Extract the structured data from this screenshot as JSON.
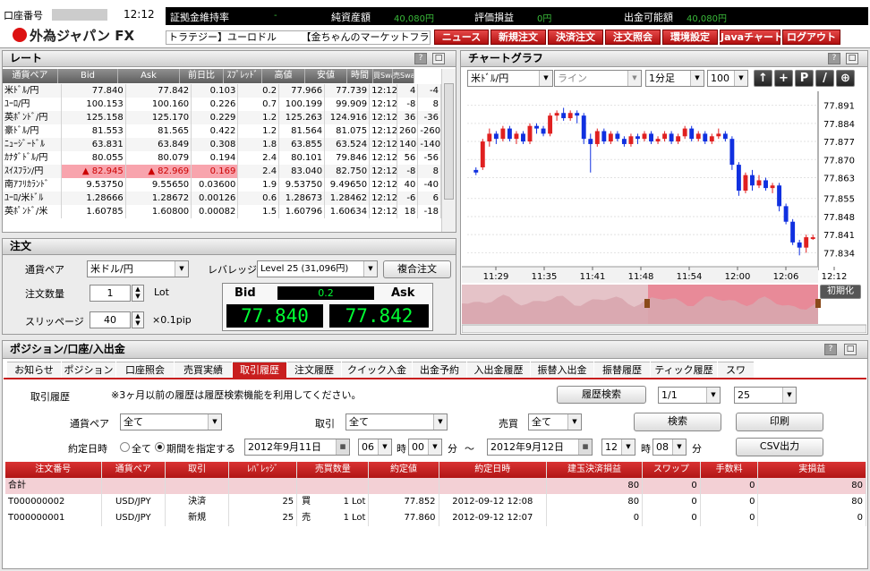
{
  "colors": {
    "accent": "#c81e1e",
    "up": "#e02020",
    "down": "#1030e0",
    "bid_green": "#00ff33"
  },
  "header": {
    "account_label": "口座番号",
    "time": "12:12",
    "logo": "外為ジャパン FX",
    "stats": [
      {
        "label": "証拠金維持率",
        "value": "-"
      },
      {
        "label": "純資産額",
        "value": "40,080円"
      },
      {
        "label": "評価損益",
        "value": "0円"
      },
      {
        "label": "出金可能額",
        "value": "40,080円"
      }
    ],
    "ticker": "トラテジー】ユーロドル　　　【金ちゃんのマーケットフラッ",
    "buttons": [
      "ニュース",
      "新規注文",
      "決済注文",
      "注文照会",
      "環境設定",
      "Javaチャート",
      "ログアウト"
    ]
  },
  "rate": {
    "title": "レート",
    "columns": [
      "通貨ペア",
      "Bid",
      "Ask",
      "前日比",
      "ｽﾌﾟﾚｯﾄﾞ",
      "高値",
      "安値",
      "時間",
      "買Swap",
      "売Swap"
    ],
    "rows": [
      [
        "米ﾄﾞﾙ/円",
        "77.840",
        "77.842",
        "0.103",
        "0.2",
        "77.966",
        "77.739",
        "12:12",
        "4",
        "-4"
      ],
      [
        "ﾕｰﾛ/円",
        "100.153",
        "100.160",
        "0.226",
        "0.7",
        "100.199",
        "99.909",
        "12:12",
        "-8",
        "8"
      ],
      [
        "英ﾎﾟﾝﾄﾞ/円",
        "125.158",
        "125.170",
        "0.229",
        "1.2",
        "125.263",
        "124.916",
        "12:12",
        "36",
        "-36"
      ],
      [
        "豪ﾄﾞﾙ/円",
        "81.553",
        "81.565",
        "0.422",
        "1.2",
        "81.564",
        "81.075",
        "12:12",
        "260",
        "-260"
      ],
      [
        "ﾆｭｰｼﾞｰﾄﾞﾙ",
        "63.831",
        "63.849",
        "0.308",
        "1.8",
        "63.855",
        "63.524",
        "12:12",
        "140",
        "-140"
      ],
      [
        "ｶﾅﾀﾞﾄﾞﾙ/円",
        "80.055",
        "80.079",
        "0.194",
        "2.4",
        "80.101",
        "79.846",
        "12:12",
        "56",
        "-56"
      ],
      [
        "ｽｲｽﾌﾗﾝ/円",
        "82.945",
        "82.969",
        "0.169",
        "2.4",
        "83.040",
        "82.750",
        "12:12",
        "-8",
        "8"
      ],
      [
        "南ｱﾌﾘｶﾗﾝﾄﾞ",
        "9.53750",
        "9.55650",
        "0.03600",
        "1.9",
        "9.53750",
        "9.49650",
        "12:12",
        "40",
        "-40"
      ],
      [
        "ﾕｰﾛ/米ﾄﾞﾙ",
        "1.28666",
        "1.28672",
        "0.00126",
        "0.6",
        "1.28673",
        "1.28462",
        "12:12",
        "-6",
        "6"
      ],
      [
        "英ﾎﾟﾝﾄﾞ/米",
        "1.60785",
        "1.60800",
        "0.00082",
        "1.5",
        "1.60796",
        "1.60634",
        "12:12",
        "18",
        "-18"
      ]
    ]
  },
  "order": {
    "title": "注文",
    "pair_label": "通貨ペア",
    "pair_value": "米ドル/円",
    "leverage_label": "レバレッジ",
    "leverage_value": "Level 25 (31,096円)",
    "combo_button": "複合注文",
    "qty_label": "注文数量",
    "qty_value": "1",
    "qty_unit": "Lot",
    "slip_label": "スリッページ",
    "slip_value": "40",
    "slip_unit": "×0.1pip",
    "bid_label": "Bid",
    "ask_label": "Ask",
    "spread": "0.2",
    "bid": "77.840",
    "ask": "77.842"
  },
  "chart": {
    "title": "チャートグラフ",
    "pair": "米ﾄﾞﾙ/円",
    "style": "ライン",
    "period": "1分足",
    "count": "100",
    "tools": [
      "↑",
      "+",
      "P",
      "/",
      "⊕"
    ],
    "reset_button": "初期化",
    "chart_data": {
      "type": "candlestick",
      "ylim": [
        77.83,
        77.895
      ],
      "yticks": [
        "77.891",
        "77.884",
        "77.877",
        "77.870",
        "77.863",
        "77.855",
        "77.848",
        "77.841",
        "77.834"
      ],
      "xticks": [
        "11:29",
        "11:35",
        "11:41",
        "11:48",
        "11:54",
        "12:00",
        "12:06",
        "12:12"
      ],
      "candles": [
        {
          "o": 77.866,
          "c": 77.865,
          "h": 77.867,
          "l": 77.864
        },
        {
          "o": 77.867,
          "c": 77.877,
          "h": 77.878,
          "l": 77.866
        },
        {
          "o": 77.877,
          "c": 77.88,
          "h": 77.882,
          "l": 77.875
        },
        {
          "o": 77.88,
          "c": 77.878,
          "h": 77.881,
          "l": 77.876
        },
        {
          "o": 77.878,
          "c": 77.882,
          "h": 77.883,
          "l": 77.877
        },
        {
          "o": 77.882,
          "c": 77.878,
          "h": 77.883,
          "l": 77.877
        },
        {
          "o": 77.878,
          "c": 77.88,
          "h": 77.881,
          "l": 77.876
        },
        {
          "o": 77.88,
          "c": 77.877,
          "h": 77.881,
          "l": 77.876
        },
        {
          "o": 77.877,
          "c": 77.883,
          "h": 77.884,
          "l": 77.876
        },
        {
          "o": 77.883,
          "c": 77.882,
          "h": 77.884,
          "l": 77.88
        },
        {
          "o": 77.882,
          "c": 77.88,
          "h": 77.883,
          "l": 77.879
        },
        {
          "o": 77.88,
          "c": 77.887,
          "h": 77.888,
          "l": 77.879
        },
        {
          "o": 77.887,
          "c": 77.888,
          "h": 77.889,
          "l": 77.885
        },
        {
          "o": 77.888,
          "c": 77.886,
          "h": 77.89,
          "l": 77.885
        },
        {
          "o": 77.886,
          "c": 77.888,
          "h": 77.889,
          "l": 77.885
        },
        {
          "o": 77.888,
          "c": 77.887,
          "h": 77.889,
          "l": 77.884
        },
        {
          "o": 77.887,
          "c": 77.878,
          "h": 77.888,
          "l": 77.876
        },
        {
          "o": 77.878,
          "c": 77.876,
          "h": 77.88,
          "l": 77.865
        },
        {
          "o": 77.876,
          "c": 77.881,
          "h": 77.882,
          "l": 77.875
        },
        {
          "o": 77.881,
          "c": 77.877,
          "h": 77.882,
          "l": 77.876
        },
        {
          "o": 77.877,
          "c": 77.88,
          "h": 77.881,
          "l": 77.876
        },
        {
          "o": 77.88,
          "c": 77.878,
          "h": 77.881,
          "l": 77.877
        },
        {
          "o": 77.878,
          "c": 77.876,
          "h": 77.879,
          "l": 77.875
        },
        {
          "o": 77.876,
          "c": 77.879,
          "h": 77.88,
          "l": 77.875
        },
        {
          "o": 77.879,
          "c": 77.878,
          "h": 77.88,
          "l": 77.876
        },
        {
          "o": 77.878,
          "c": 77.88,
          "h": 77.881,
          "l": 77.877
        },
        {
          "o": 77.88,
          "c": 77.877,
          "h": 77.881,
          "l": 77.876
        },
        {
          "o": 77.877,
          "c": 77.878,
          "h": 77.879,
          "l": 77.876
        },
        {
          "o": 77.878,
          "c": 77.88,
          "h": 77.881,
          "l": 77.877
        },
        {
          "o": 77.88,
          "c": 77.877,
          "h": 77.881,
          "l": 77.876
        },
        {
          "o": 77.877,
          "c": 77.879,
          "h": 77.88,
          "l": 77.876
        },
        {
          "o": 77.879,
          "c": 77.882,
          "h": 77.883,
          "l": 77.878
        },
        {
          "o": 77.882,
          "c": 77.878,
          "h": 77.883,
          "l": 77.877
        },
        {
          "o": 77.878,
          "c": 77.88,
          "h": 77.881,
          "l": 77.877
        },
        {
          "o": 77.88,
          "c": 77.877,
          "h": 77.881,
          "l": 77.876
        },
        {
          "o": 77.877,
          "c": 77.879,
          "h": 77.88,
          "l": 77.876
        },
        {
          "o": 77.879,
          "c": 77.88,
          "h": 77.882,
          "l": 77.878
        },
        {
          "o": 77.88,
          "c": 77.878,
          "h": 77.881,
          "l": 77.877
        },
        {
          "o": 77.878,
          "c": 77.868,
          "h": 77.879,
          "l": 77.866
        },
        {
          "o": 77.868,
          "c": 77.858,
          "h": 77.869,
          "l": 77.856
        },
        {
          "o": 77.858,
          "c": 77.864,
          "h": 77.865,
          "l": 77.857
        },
        {
          "o": 77.864,
          "c": 77.86,
          "h": 77.866,
          "l": 77.858
        },
        {
          "o": 77.86,
          "c": 77.862,
          "h": 77.864,
          "l": 77.859
        },
        {
          "o": 77.862,
          "c": 77.859,
          "h": 77.863,
          "l": 77.858
        },
        {
          "o": 77.859,
          "c": 77.86,
          "h": 77.861,
          "l": 77.857
        },
        {
          "o": 77.86,
          "c": 77.852,
          "h": 77.861,
          "l": 77.85
        },
        {
          "o": 77.852,
          "c": 77.846,
          "h": 77.853,
          "l": 77.845
        },
        {
          "o": 77.846,
          "c": 77.838,
          "h": 77.847,
          "l": 77.837
        },
        {
          "o": 77.838,
          "c": 77.836,
          "h": 77.839,
          "l": 77.833
        },
        {
          "o": 77.836,
          "c": 77.84,
          "h": 77.841,
          "l": 77.834
        },
        {
          "o": 77.84,
          "c": 77.84,
          "h": 77.841,
          "l": 77.839
        }
      ]
    }
  },
  "position": {
    "title": "ポジション/口座/入出金",
    "tabs": [
      "お知らせ",
      "ポジション",
      "口座照会",
      "売買実績",
      "取引履歴",
      "注文履歴",
      "クイック入金",
      "出金予約",
      "入出金履歴",
      "振替入出金",
      "振替履歴",
      "ティック履歴",
      "スワ"
    ],
    "active_tab": 4,
    "history_label": "取引履歴",
    "note": "※3ヶ月以前の履歴は履歴検索機能を利用してください。",
    "search_history_btn": "履歴検索",
    "page": "1/1",
    "page_size": "25",
    "pair_label": "通貨ペア",
    "pair_value": "全て",
    "trade_label": "取引",
    "trade_value": "全て",
    "side_label": "売買",
    "side_value": "全て",
    "search_btn": "検索",
    "print_btn": "印刷",
    "csv_btn": "CSV出力",
    "date_label": "約定日時",
    "radio_all": "全て",
    "radio_period": "期間を指定する",
    "from_date": "2012年9月11日",
    "from_hour": "06",
    "hour_unit": "時",
    "from_min": "00",
    "min_unit": "分",
    "tilde": "〜",
    "to_date": "2012年9月12日",
    "to_hour": "12",
    "to_min": "08",
    "columns": [
      "注文番号",
      "通貨ペア",
      "取引",
      "ﾚﾊﾞﾚｯｼﾞ",
      "売買数量",
      "約定値",
      "約定日時",
      "建玉決済損益",
      "スワップ",
      "手数料",
      "実損益"
    ],
    "total": {
      "label": "合計",
      "pl": "80",
      "swap": "0",
      "fee": "0",
      "net": "80"
    },
    "rows": [
      {
        "no": "T000000002",
        "pair": "USD/JPY",
        "trade": "決済",
        "lev": "25",
        "side": "買",
        "qty": "1",
        "unit": "Lot",
        "price": "77.852",
        "time": "2012-09-12 12:08",
        "pl": "80",
        "swap": "0",
        "fee": "0",
        "net": "80"
      },
      {
        "no": "T000000001",
        "pair": "USD/JPY",
        "trade": "新規",
        "lev": "25",
        "side": "売",
        "qty": "1",
        "unit": "Lot",
        "price": "77.860",
        "time": "2012-09-12 12:07",
        "pl": "0",
        "swap": "0",
        "fee": "0",
        "net": "0"
      }
    ]
  }
}
